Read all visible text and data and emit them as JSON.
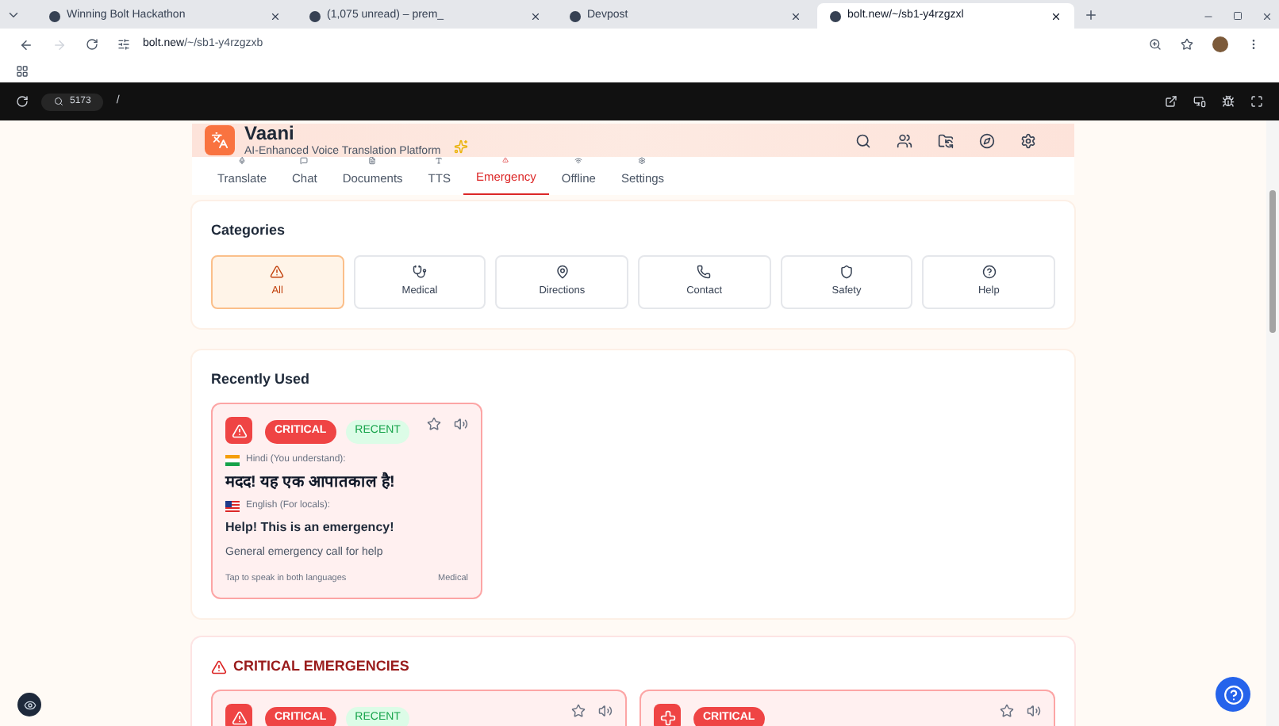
{
  "browser": {
    "tabs": [
      {
        "title": "Winning Bolt Hackathon",
        "selected": false
      },
      {
        "title": "(1,075 unread) – prem_",
        "selected": false
      },
      {
        "title": "Devpost",
        "selected": false
      },
      {
        "title": "bolt.new/~/sb1-y4rzgzxl",
        "selected": true
      }
    ],
    "url_host": "bolt.new",
    "url_path": "/~/sb1-y4rzgzxb"
  },
  "preview_bar": {
    "port": "5173",
    "path": "/"
  },
  "app": {
    "name": "Vaani",
    "tagline": "AI-Enhanced Voice Translation Platform"
  },
  "nav": [
    {
      "label": "Translate",
      "kind": "translate",
      "selected": false
    },
    {
      "label": "Chat",
      "kind": "chat",
      "selected": false
    },
    {
      "label": "Documents",
      "kind": "documents",
      "selected": false
    },
    {
      "label": "TTS",
      "kind": "tts",
      "selected": false
    },
    {
      "label": "Emergency",
      "kind": "emergency",
      "selected": true
    },
    {
      "label": "Offline",
      "kind": "offline",
      "selected": false
    },
    {
      "label": "Settings",
      "kind": "settings",
      "selected": false
    }
  ],
  "categories": {
    "title": "Categories",
    "items": [
      {
        "label": "All",
        "kind": "all",
        "selected": true
      },
      {
        "label": "Medical",
        "kind": "medical",
        "selected": false
      },
      {
        "label": "Directions",
        "kind": "directions",
        "selected": false
      },
      {
        "label": "Contact",
        "kind": "contact",
        "selected": false
      },
      {
        "label": "Safety",
        "kind": "safety",
        "selected": false
      },
      {
        "label": "Help",
        "kind": "help",
        "selected": false
      }
    ]
  },
  "recently_used": {
    "title": "Recently Used",
    "cards": [
      {
        "kind": "alert",
        "badge": "CRITICAL",
        "recent_badge": "RECENT",
        "source_label": "Hindi (You understand):",
        "source_text": "मदद! यह एक आपातकाल है!",
        "target_label": "English (For locals):",
        "target_text": "Help! This is an emergency!",
        "description": "General emergency call for help",
        "hint": "Tap to speak in both languages",
        "category": "Medical"
      }
    ]
  },
  "critical": {
    "title": "CRITICAL EMERGENCIES",
    "cards": [
      {
        "kind": "alert",
        "badge": "CRITICAL",
        "recent_badge": "RECENT"
      },
      {
        "kind": "medical",
        "badge": "CRITICAL"
      }
    ]
  }
}
